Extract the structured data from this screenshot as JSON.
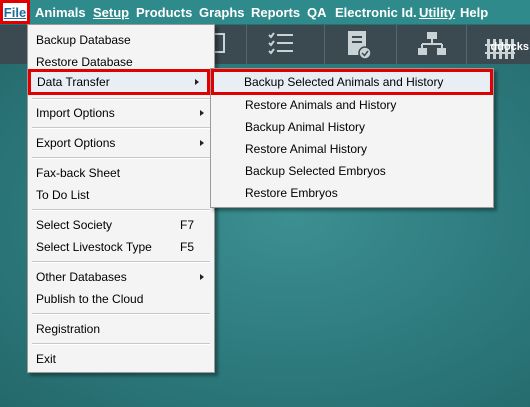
{
  "menubar": {
    "items": [
      {
        "label": "File"
      },
      {
        "label": "Animals"
      },
      {
        "label": "Setup"
      },
      {
        "label": "Products"
      },
      {
        "label": "Graphs"
      },
      {
        "label": "Reports"
      },
      {
        "label": "QA"
      },
      {
        "label": "Electronic Id."
      },
      {
        "label": "Utility"
      },
      {
        "label": "Help"
      }
    ]
  },
  "toolbar": {
    "buttons": [
      {
        "icon": "checklist-icon"
      },
      {
        "icon": "document-check-icon"
      },
      {
        "icon": "hierarchy-icon"
      },
      {
        "icon": "fence-icon",
        "label": "ddocks"
      }
    ]
  },
  "file_menu": {
    "items": [
      {
        "label": "Backup Database"
      },
      {
        "label": "Restore Database"
      },
      {
        "label": "Data Transfer",
        "submenu": true
      },
      {
        "label": "Import Options",
        "submenu": true
      },
      {
        "label": "Export Options",
        "submenu": true
      },
      {
        "label": "Fax-back Sheet"
      },
      {
        "label": "To Do List"
      },
      {
        "label": "Select Society",
        "shortcut": "F7"
      },
      {
        "label": "Select Livestock Type",
        "shortcut": "F5"
      },
      {
        "label": "Other Databases",
        "submenu": true
      },
      {
        "label": "Publish to the Cloud"
      },
      {
        "label": "Registration"
      },
      {
        "label": "Exit"
      }
    ]
  },
  "data_transfer_menu": {
    "items": [
      {
        "label": "Backup Selected Animals and History"
      },
      {
        "label": "Restore Animals and History"
      },
      {
        "label": "Backup Animal History"
      },
      {
        "label": "Restore Animal History"
      },
      {
        "label": "Backup Selected Embryos"
      },
      {
        "label": "Restore Embryos"
      }
    ]
  },
  "colors": {
    "menubar_bg": "#2f8a8b",
    "toolbar_bg": "#3a4a50",
    "desktop_bg": "#2d7a7d",
    "highlight_border": "#e00000"
  }
}
